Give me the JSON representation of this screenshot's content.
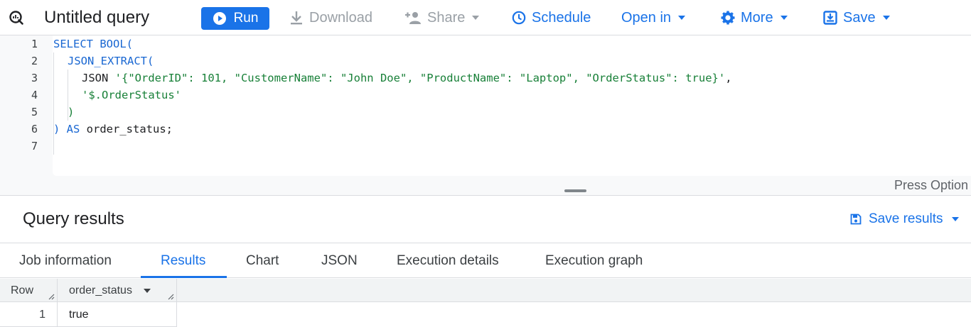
{
  "toolbar": {
    "title": "Untitled query",
    "run_label": "Run",
    "download_label": "Download",
    "share_label": "Share",
    "schedule_label": "Schedule",
    "open_in_label": "Open in",
    "more_label": "More",
    "save_label": "Save",
    "accent_color": "#1a73e8"
  },
  "editor": {
    "line_numbers": [
      "1",
      "2",
      "3",
      "4",
      "5",
      "6",
      "7"
    ],
    "lines": [
      [
        {
          "t": "SELECT BOOL(",
          "k": "kw"
        }
      ],
      [
        {
          "t": "JSON_EXTRACT(",
          "k": "kw"
        }
      ],
      [
        {
          "t": "JSON ",
          "k": "plain"
        },
        {
          "t": "'{\"OrderID\": 101, \"CustomerName\": \"John Doe\", \"ProductName\": \"Laptop\", \"OrderStatus\": true}'",
          "k": "str"
        },
        {
          "t": ",",
          "k": "plain"
        }
      ],
      [
        {
          "t": "'$.OrderStatus'",
          "k": "str"
        }
      ],
      [
        {
          "t": ")",
          "k": "str"
        }
      ],
      [
        {
          "t": ") AS ",
          "k": "kw"
        },
        {
          "t": "order_status;",
          "k": "plain"
        }
      ],
      []
    ],
    "hint_text": "Press Option"
  },
  "results": {
    "title": "Query results",
    "save_results_label": "Save results",
    "tabs": [
      "Job information",
      "Results",
      "Chart",
      "JSON",
      "Execution details",
      "Execution graph"
    ],
    "active_tab": "Results",
    "columns": [
      "Row",
      "order_status"
    ],
    "rows": [
      [
        "1",
        "true"
      ]
    ]
  }
}
